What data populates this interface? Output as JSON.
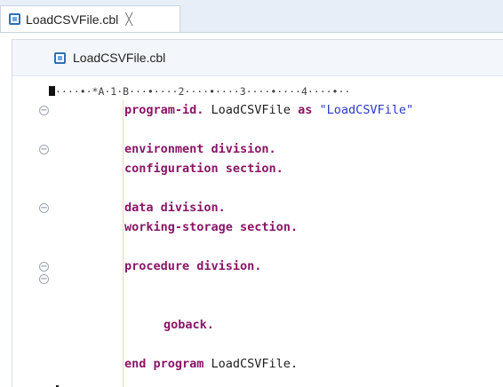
{
  "tab": {
    "title": "LoadCSVFile.cbl",
    "close_glyph": "╳"
  },
  "breadcrumb": {
    "file": "LoadCSVFile.cbl"
  },
  "ruler": {
    "text": "····•·*A·1·B···•····2····•····3····•····4····•··"
  },
  "code": {
    "line1": {
      "kw1": "program-id.",
      "id1": " LoadCSVFile ",
      "kw2": "as",
      "str": " \"LoadCSVFile\""
    },
    "line2": "environment division.",
    "line3": "configuration section.",
    "line4": "data division.",
    "line5": "working-storage section.",
    "line6": "procedure division.",
    "line7": "goback.",
    "line8": {
      "kw1": "end program",
      "id1": " LoadCSVFile."
    }
  },
  "fold_glyph": "−",
  "colors": {
    "keyword": "#8a1565",
    "string": "#2a39c7",
    "tabbar": "#e7eef7"
  }
}
